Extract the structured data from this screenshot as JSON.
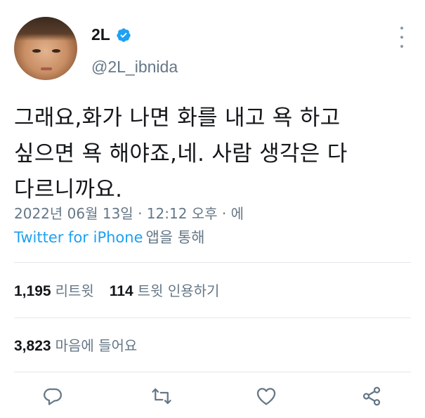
{
  "user": {
    "display_name": "2L",
    "handle": "@2L_ibnida",
    "verified": true
  },
  "tweet": {
    "lines": [
      "그래요,화가 나면 화를 내고 욕 하고",
      "싶으면 욕 해야죠,네. 사람 생각은 다",
      "다르니까요."
    ],
    "timestamp": "2022년 06월 13일 · 12:12 오후 · 에",
    "source": "Twitter for iPhone",
    "source_suffix": "앱을 통해"
  },
  "stats": {
    "retweets": "1,195",
    "retweets_label": "리트윗",
    "quotes": "114",
    "quotes_label": "트윗 인용하기",
    "likes": "3,823",
    "likes_label": "마음에 들어요"
  },
  "icons": {
    "more": "more-vertical-icon",
    "verified": "verified-badge-icon",
    "reply": "reply-icon",
    "retweet": "retweet-icon",
    "like": "heart-icon",
    "share": "share-icon"
  },
  "colors": {
    "accent": "#1da1f2",
    "text": "#14171a",
    "secondary": "#657786",
    "divider": "#e1e8ed"
  }
}
